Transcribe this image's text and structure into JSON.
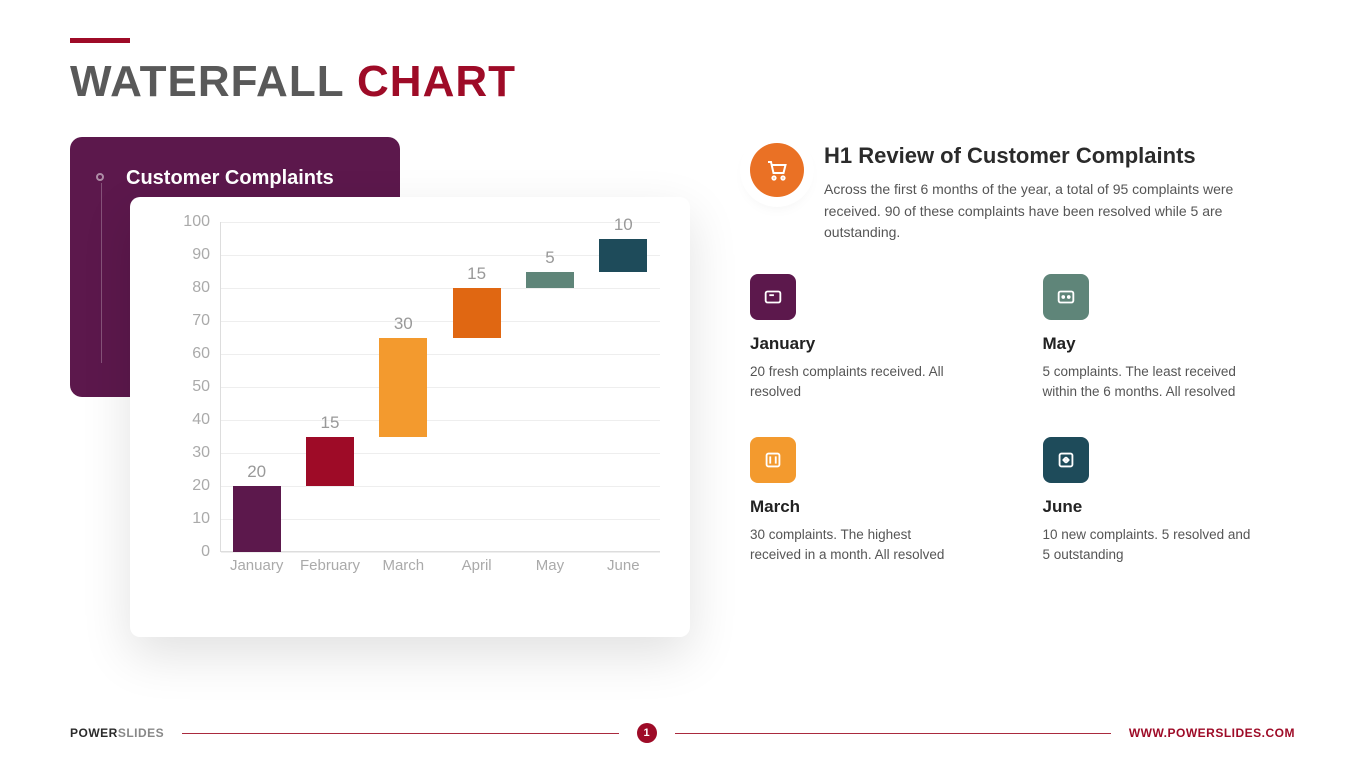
{
  "title": {
    "word1": "WATERFALL",
    "word2": "CHART"
  },
  "chart_data": {
    "type": "bar",
    "title": "Customer Complaints",
    "xlabel": "",
    "ylabel": "",
    "ylim": [
      0,
      100
    ],
    "y_ticks": [
      0,
      10,
      20,
      30,
      40,
      50,
      60,
      70,
      80,
      90,
      100
    ],
    "categories": [
      "January",
      "February",
      "March",
      "April",
      "May",
      "June"
    ],
    "values": [
      20,
      15,
      30,
      15,
      5,
      10
    ],
    "cumulative_start": [
      0,
      20,
      35,
      65,
      80,
      85
    ],
    "cumulative_end": [
      20,
      35,
      65,
      80,
      85,
      95
    ],
    "colors": [
      "#5c184c",
      "#9e0b27",
      "#f39a2e",
      "#e06712",
      "#5f8579",
      "#1e4b5a"
    ]
  },
  "review": {
    "heading": "H1 Review of Customer Complaints",
    "body": "Across the first 6 months of the year, a total of 95 complaints were received. 90 of these complaints have been resolved while 5 are outstanding."
  },
  "months": [
    {
      "title": "January",
      "body": "20 fresh complaints received. All resolved",
      "color": "#5c184c"
    },
    {
      "title": "May",
      "body": "5 complaints. The least received within the 6 months. All resolved",
      "color": "#5f8579"
    },
    {
      "title": "March",
      "body": "30 complaints. The highest received in a month. All resolved",
      "color": "#f39a2e"
    },
    {
      "title": "June",
      "body": "10 new complaints. 5 resolved and 5 outstanding",
      "color": "#1e4b5a"
    }
  ],
  "footer": {
    "brand_left_1": "POWER",
    "brand_left_2": "SLIDES",
    "page": "1",
    "brand_right": "WWW.POWERSLIDES.COM"
  }
}
